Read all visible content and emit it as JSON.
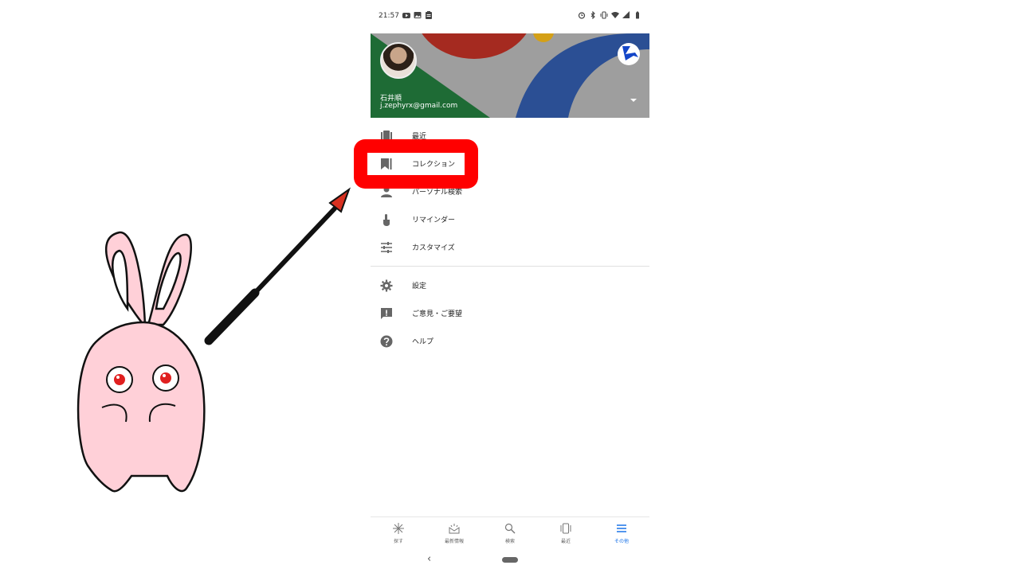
{
  "status_bar": {
    "time": "21:57",
    "left_icons": [
      "youtube-icon",
      "image-icon",
      "clipboard-icon"
    ],
    "right_icons": [
      "alarm-icon",
      "bluetooth-icon",
      "vibrate-icon",
      "wifi-icon",
      "signal-icon",
      "battery-icon"
    ]
  },
  "drawer_header": {
    "user_name": "石井順",
    "user_email": "j.zephyrx@gmail.com",
    "colors": {
      "green": "#1e6b35",
      "red": "#a52a20",
      "blue": "#2b4f94",
      "yellow": "#d4a017",
      "gray": "#9e9e9e"
    }
  },
  "menu": {
    "group1": [
      {
        "label": "最近",
        "icon": "recent-icon"
      },
      {
        "label": "コレクション",
        "icon": "bookmark-icon"
      },
      {
        "label": "パーソナル検索",
        "icon": "person-icon"
      },
      {
        "label": "リマインダー",
        "icon": "pointer-hand-icon"
      },
      {
        "label": "カスタマイズ",
        "icon": "tune-icon"
      }
    ],
    "group2": [
      {
        "label": "設定",
        "icon": "gear-icon"
      },
      {
        "label": "ご意見・ご要望",
        "icon": "feedback-icon"
      },
      {
        "label": "ヘルプ",
        "icon": "help-icon"
      }
    ]
  },
  "bottom_nav": {
    "items": [
      {
        "label": "探す",
        "icon": "sparkle-icon"
      },
      {
        "label": "最新情報",
        "icon": "updates-icon"
      },
      {
        "label": "検索",
        "icon": "search-icon"
      },
      {
        "label": "最近",
        "icon": "tabs-icon"
      },
      {
        "label": "その他",
        "icon": "menu-icon"
      }
    ],
    "active_index": 4,
    "active_color": "#1a73e8"
  },
  "annotation": {
    "highlight_color": "#ff0000",
    "target": "コレクション",
    "character": "pink-rabbit",
    "rabbit_color": "#ffd0d8",
    "arrow_tip_color": "#d83020"
  }
}
